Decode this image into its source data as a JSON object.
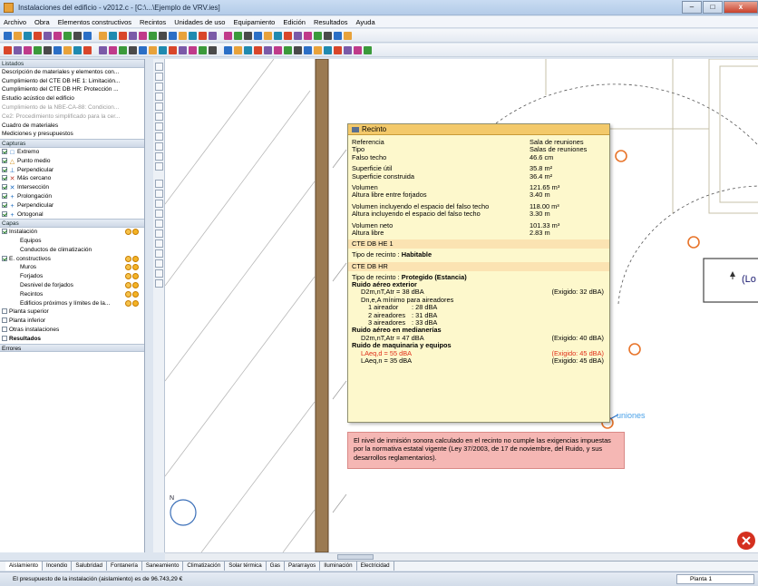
{
  "window": {
    "title": "Instalaciones del edificio - v2012.c - [C:\\...\\Ejemplo de VRV.ies]",
    "min_label": "–",
    "max_label": "□",
    "close_label": "x"
  },
  "menu": [
    "Archivo",
    "Obra",
    "Elementos constructivos",
    "Recintos",
    "Unidades de uso",
    "Equipamiento",
    "Edición",
    "Resultados",
    "Ayuda"
  ],
  "sidebar": {
    "listados_header": "Listados",
    "listados": [
      {
        "label": "Descripción de materiales y elementos con...",
        "disabled": false
      },
      {
        "label": "Cumplimiento del CTE DB HE 1: Limitación...",
        "disabled": false
      },
      {
        "label": "Cumplimiento del CTE DB HR: Protección ...",
        "disabled": false
      },
      {
        "label": "Estudio acústico del edificio",
        "disabled": false
      },
      {
        "label": "Cumplimiento de la NBE-CA-88: Condicion...",
        "disabled": true
      },
      {
        "label": "Ce2: Procedimiento simplificado para la cer...",
        "disabled": true
      },
      {
        "label": "Cuadro de materiales",
        "disabled": false
      },
      {
        "label": "Mediciones y presupuestos",
        "disabled": false
      }
    ],
    "capturas_header": "Capturas",
    "capturas": [
      {
        "label": "Extremo",
        "icon": "square-snap-icon",
        "checked": true
      },
      {
        "label": "Punto medio",
        "icon": "triangle-snap-icon",
        "checked": true
      },
      {
        "label": "Perpendicular",
        "icon": "perpendicular-snap-icon",
        "checked": true
      },
      {
        "label": "Más cercano",
        "icon": "nearest-snap-icon",
        "checked": true
      },
      {
        "label": "Intersección",
        "icon": "intersection-snap-icon",
        "checked": true
      },
      {
        "label": "Prolongación",
        "icon": "plus-snap-icon",
        "checked": true
      },
      {
        "label": "Perpendicular",
        "icon": "plus-snap-icon",
        "checked": true
      },
      {
        "label": "Ortogonal",
        "icon": "plus-snap-icon",
        "checked": true
      }
    ],
    "capas_header": "Capas",
    "capas": [
      {
        "label": "Instalación",
        "checked": true,
        "indent": false,
        "lamps": true
      },
      {
        "label": "Equipos",
        "checked": null,
        "indent": true,
        "lamps": false
      },
      {
        "label": "Conductos de climatización",
        "checked": null,
        "indent": true,
        "lamps": false
      },
      {
        "label": "E. constructivos",
        "checked": true,
        "indent": false,
        "lamps": true
      },
      {
        "label": "Muros",
        "checked": null,
        "indent": true,
        "lamps": true
      },
      {
        "label": "Forjados",
        "checked": null,
        "indent": true,
        "lamps": true
      },
      {
        "label": "Desnivel de forjados",
        "checked": null,
        "indent": true,
        "lamps": true
      },
      {
        "label": "Recintos",
        "checked": null,
        "indent": true,
        "lamps": true
      },
      {
        "label": "Edificios próximos y límites de la...",
        "checked": null,
        "indent": true,
        "lamps": true
      },
      {
        "label": "Planta superior",
        "checked": false,
        "indent": false,
        "lamps": false
      },
      {
        "label": "Planta inferior",
        "checked": false,
        "indent": false,
        "lamps": false
      },
      {
        "label": "Otras instalaciones",
        "checked": false,
        "indent": false,
        "lamps": false
      },
      {
        "label": "Resultados",
        "checked": false,
        "indent": false,
        "lamps": false,
        "bold": true
      }
    ],
    "errores_header": "Errores"
  },
  "tooltip": {
    "title": "Recinto",
    "rows": [
      {
        "label": "Referencia",
        "value": "Sala de reuniones"
      },
      {
        "label": "Tipo",
        "value": "Salas de reuniones"
      },
      {
        "label": "Falso techo",
        "value": "46.6 cm"
      },
      {
        "label": "",
        "value": ""
      },
      {
        "label": "Superficie útil",
        "value": "35.8 m²"
      },
      {
        "label": "Superficie construida",
        "value": "36.4 m²"
      },
      {
        "label": "",
        "value": ""
      },
      {
        "label": "Volumen",
        "value": "121.65 m³"
      },
      {
        "label": "Altura libre entre forjados",
        "value": "3.40 m"
      },
      {
        "label": "",
        "value": ""
      },
      {
        "label": "Volumen incluyendo el espacio del falso techo",
        "value": "118.00 m³"
      },
      {
        "label": "Altura incluyendo el espacio del falso techo",
        "value": "3.30 m"
      },
      {
        "label": "",
        "value": ""
      },
      {
        "label": "Volumen neto",
        "value": "101.33 m³"
      },
      {
        "label": "Altura libre",
        "value": "2.83 m"
      }
    ],
    "he1_header": "CTE DB HE 1",
    "he1_tipo_label": "Tipo de recinto",
    "he1_tipo_value": "Habitable",
    "hr_header": "CTE DB HR",
    "hr_tipo_label": "Tipo de recinto",
    "hr_tipo_value": "Protegido (Estancia)",
    "ruido_exterior_title": "Ruido aéreo exterior",
    "d2m_label": "D2m,nT,Atr = 38 dBA",
    "d2m_req": "(Exigido: 32 dBA)",
    "aireadores_label": "Dn,e,A mínimo para aireadores",
    "aireadores": [
      {
        "label": "1 aireador",
        "value": ": 28 dBA"
      },
      {
        "label": "2 aireadores",
        "value": ": 31 dBA"
      },
      {
        "label": "3 aireadores",
        "value": ": 33 dBA"
      }
    ],
    "medianerias_title": "Ruido aéreo en medianerías",
    "d2m_med_label": "D2m,nT,Atr = 47 dBA",
    "d2m_med_req": "(Exigido: 40 dBA)",
    "maquinaria_title": "Ruido de maquinaria y equipos",
    "laeqd_label": "LAeq,d = 55 dBA",
    "laeqd_req": "(Exigido: 45 dBA)",
    "laeqn_label": "LAeq,n = 35 dBA",
    "laeqn_req": "(Exigido: 45 dBA)"
  },
  "alert": {
    "message": "El nivel de inmisión sonora calculado en el recinto no cumple las exigencias impuestas por la normativa estatal vigente (Ley 37/2003, de 17 de noviembre, del Ruido, y sus desarrollos reglamentarios)."
  },
  "canvas": {
    "room_label_partial": "uniones",
    "right_label_partial": "(Lo"
  },
  "bottom_tabs": [
    "Aislamiento",
    "Incendio",
    "Salubridad",
    "Fontanería",
    "Saneamiento",
    "Climatización",
    "Solar térmica",
    "Gas",
    "Pararrayos",
    "Iluminación",
    "Electricidad"
  ],
  "status": {
    "text": "El presupuesto de la instalación (aislamiento) es de 96.743,29 €",
    "planta": "Planta 1"
  },
  "colors": {
    "tooltip_bg": "#fdf8cc",
    "tooltip_header": "#f3c96a",
    "alert_bg": "#f5b7b4",
    "fail_text": "#e0301a",
    "wall": "#9b7a52"
  }
}
